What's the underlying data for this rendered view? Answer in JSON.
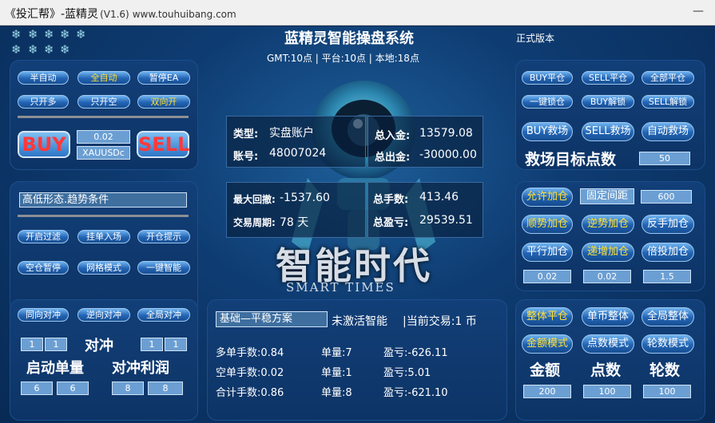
{
  "window": {
    "title": "《投汇帮》-蓝精灵",
    "version": "(V1.6)",
    "url": "www.touhuibang.com",
    "minimize": "—"
  },
  "header": {
    "title": "蓝精灵智能操盘系统",
    "edition": "正式版本",
    "time_line": "GMT:10点 | 平台:10点 | 本地:18点"
  },
  "left_top": {
    "mode_buttons": [
      "半自动",
      "全自动",
      "暂停EA"
    ],
    "direction_buttons": [
      "只开多",
      "只开空",
      "双向开"
    ],
    "buy_label": "BUY",
    "sell_label": "SELL",
    "lot": "0.02",
    "symbol": "XAUUSDc"
  },
  "left_mid": {
    "condition": "高低形态.趋势条件",
    "row1": [
      "开启过滤",
      "挂单入场",
      "开仓提示"
    ],
    "row2": [
      "空仓暂停",
      "网格模式",
      "一键智能"
    ]
  },
  "left_bottom": {
    "hedge_buttons": [
      "同向对冲",
      "逆向对冲",
      "全局对冲"
    ],
    "hedge_label": "对冲",
    "left_values": [
      "1",
      "1"
    ],
    "right_values": [
      "1",
      "1"
    ],
    "start_lot_label": "启动单量",
    "hedge_profit_label": "对冲利润",
    "start_lot_values": [
      "6",
      "6"
    ],
    "hedge_profit_values": [
      "8",
      "8"
    ]
  },
  "center": {
    "type_label": "类型:",
    "type_value": "实盘账户",
    "account_label": "账号:",
    "account_value": "48007024",
    "deposit_label": "总入金:",
    "deposit_value": "13579.08",
    "withdraw_label": "总出金:",
    "withdraw_value": "-30000.00",
    "drawdown_label": "最大回撤:",
    "drawdown_value": "-1537.60",
    "period_label": "交易周期:",
    "period_value": "78 天",
    "lots_label": "总手数:",
    "lots_value": "413.46",
    "pnl_label": "总盈亏:",
    "pnl_value": "29539.51",
    "banner_cn": "智能时代",
    "banner_en": "SMART TIMES"
  },
  "center_bottom": {
    "scheme": "基础—平稳方案",
    "smart_status": "未激活智能",
    "current_trade": "|当前交易:1 币",
    "rows": [
      {
        "a": "多单手数:0.84",
        "b": "单量:7",
        "c": "盈亏:-626.11"
      },
      {
        "a": "空单手数:0.02",
        "b": "单量:1",
        "c": "盈亏:5.01"
      },
      {
        "a": "合计手数:0.86",
        "b": "单量:8",
        "c": "盈亏:-621.10"
      }
    ]
  },
  "right_top": {
    "close_buttons": [
      "BUY平仓",
      "SELL平仓",
      "全部平仓"
    ],
    "lock_buttons": [
      "一键锁仓",
      "BUY解锁",
      "SELL解锁"
    ],
    "rescue_buttons": [
      "BUY救场",
      "SELL救场",
      "自动救场"
    ],
    "rescue_target_label": "救场目标点数",
    "rescue_target_value": "50"
  },
  "right_mid": {
    "allow_add": "允许加仓",
    "fixed_spacing": "固定间距",
    "spacing_value": "600",
    "row2": [
      "顺势加仓",
      "逆势加仓",
      "反手加仓"
    ],
    "row3": [
      "平行加仓",
      "递增加仓",
      "倍投加仓"
    ],
    "values": [
      "0.02",
      "0.02",
      "1.5"
    ]
  },
  "right_bottom": {
    "close_buttons": [
      "整体平仓",
      "单币整体",
      "全局整体"
    ],
    "mode_buttons": [
      "金额模式",
      "点数模式",
      "轮数模式"
    ],
    "labels": [
      "金额",
      "点数",
      "轮数"
    ],
    "values": [
      "200",
      "100",
      "100"
    ]
  }
}
